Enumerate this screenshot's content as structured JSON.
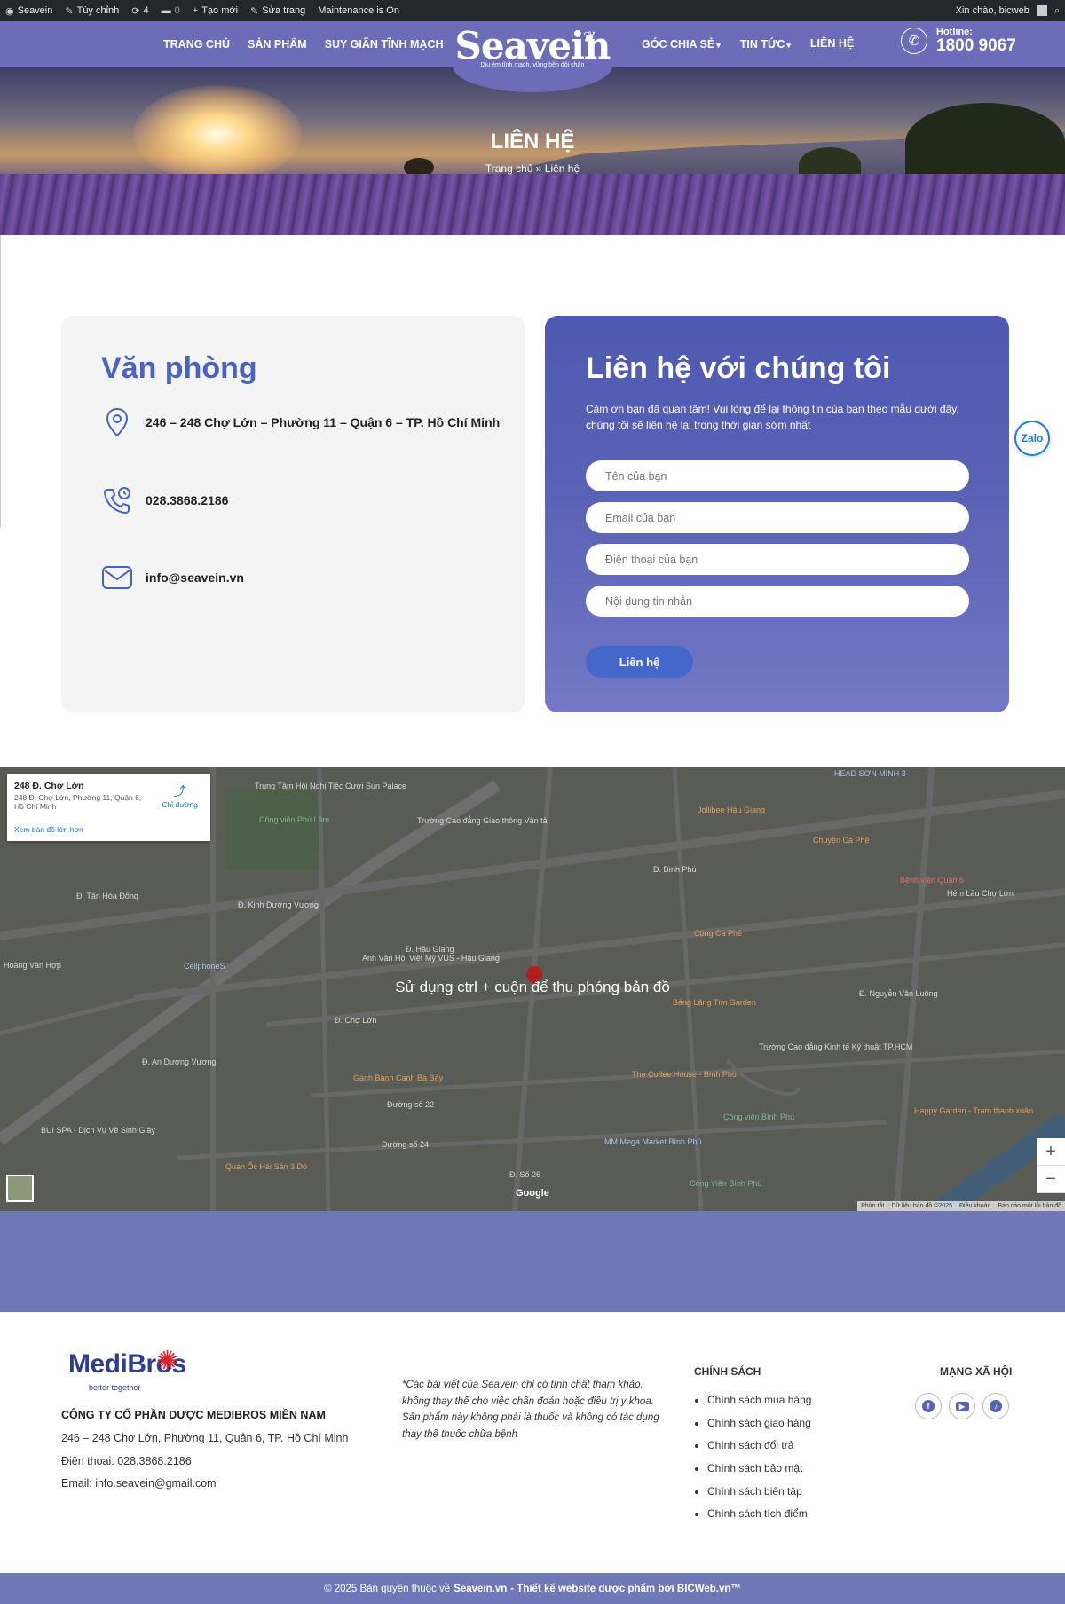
{
  "adminbar": {
    "site": "Seavein",
    "customize": "Tùy chỉnh",
    "updates": "4",
    "comments": "0",
    "new": "Tạo mới",
    "edit": "Sửa trang",
    "maintenance": "Maintenance is On",
    "greeting": "Xin chào, bicweb"
  },
  "header": {
    "nav_left": [
      "TRANG CHỦ",
      "SẢN PHẨM",
      "SUY GIÃN TĨNH MẠCH"
    ],
    "nav_right": [
      "GÓC CHIA SẺ",
      "TIN TỨC",
      "LIÊN HỆ"
    ],
    "logo": "Seavein",
    "logo_tagline": "Dịu êm tĩnh mạch, vững bền đôi chân",
    "hotline_label": "Hotline:",
    "hotline_number": "1800 9067"
  },
  "banner": {
    "title": "LIÊN HỆ",
    "breadcrumb": "Trang chủ » Liên hệ"
  },
  "office": {
    "title": "Văn phòng",
    "address": "246 – 248 Chợ Lớn – Phường 11 – Quận 6 – TP. Hồ Chí Minh",
    "phone": "028.3868.2186",
    "email": "info@seavein.vn",
    "icons": [
      "location-icon",
      "phone-icon",
      "mail-icon"
    ]
  },
  "contact": {
    "title": "Liên hệ với chúng tôi",
    "description": "Cảm ơn bạn đã quan tâm! Vui lòng để lại thông tin của bạn theo mẫu dưới đây, chúng tôi sẽ liên hệ lại trong thời gian sớm nhất",
    "fields": {
      "name": "Tên của bạn",
      "email": "Email của bạn",
      "phone": "Điện thoại của bạn",
      "message": "Nội dung tin nhắn"
    },
    "submit": "Liên hệ"
  },
  "zalo": "Zalo",
  "map": {
    "card_title": "248 Đ. Chợ Lớn",
    "card_address": "248 Đ. Chợ Lớn, Phường 11, Quận 6, Hồ Chí Minh",
    "card_link": "Xem bản đồ lớn hơn",
    "directions": "Chỉ đường",
    "hint": "Sử dụng ctrl + cuộn để thu phóng bản đồ",
    "zoom_in": "+",
    "zoom_out": "−",
    "google": "Google",
    "footer_links": [
      "Phím tắt",
      "Dữ liệu bản đồ ©2025",
      "Điều khoản",
      "Báo cáo một lỗi bản đồ"
    ],
    "labels": [
      "Trung Tâm Hội Nghị Tiệc Cưới Sun Palace",
      "Công viên Phú Lâm",
      "Trường Cao đẳng Giao thông Vận tải",
      "Jollibee Hậu Giang",
      "Chuyện Cà Phê",
      "Bệnh viện Quận 6",
      "Hẻm Lầu Chợ Lớn",
      "HEAD SƠN MINH 3",
      "Cộng Cà Phê",
      "Anh Văn Hội Việt Mỹ VUS - Hậu Giang",
      "CellphoneS",
      "Bảng Lăng Tím Garden",
      "Gánh Bánh Canh Bà Bảy",
      "The Coffee House - Bình Phú",
      "Trường Cao đẳng Kinh tế Kỹ thuật TP.HCM",
      "Công viên Bình Phú",
      "Happy Garden - Trạm thanh xuân",
      "MM Mega Market Bình Phú",
      "BUI SPA - Dịch Vụ Về Sinh Giày",
      "Quán Ốc Hải Sản 3 Dô",
      "Công Viên Bình Phú",
      "Đ. Hậu Giang",
      "Đ. Chợ Lớn",
      "Đ. Kinh Dương Vương",
      "Hoàng Văn Hợp",
      "Đường số 22",
      "Đường số 24",
      "Đ. Số 26",
      "Đ. An Dương Vương",
      "Đ. Nguyễn Văn Luông",
      "Đ. Bình Phú",
      "Đ. Tân Hòa Đông"
    ]
  },
  "footer": {
    "brand": "MediBros",
    "brand_tagline": "better together",
    "company": "CÔNG TY CỔ PHẦN DƯỢC MEDIBROS MIỀN NAM",
    "address": "246 – 248 Chợ Lớn, Phường 11, Quận 6, TP. Hồ Chí Minh",
    "phone": "Điện thoại: 028.3868.2186",
    "email": "Email: info.seavein@gmail.com",
    "note": "*Các bài viết của Seavein chỉ có tính chất tham khảo, không thay thế cho việc chẩn đoán hoặc điều trị y khoa. Sản phẩm này không phải là thuốc và không có tác dụng thay thế thuốc chữa bệnh",
    "policy_title": "CHÍNH SÁCH",
    "policies": [
      "Chính sách mua hàng",
      "Chính sách giao hàng",
      "Chính sách đổi trả",
      "Chính sách bảo mật",
      "Chính sách biên tập",
      "Chính sách tích điểm"
    ],
    "social_title": "MẠNG XÃ HỘI",
    "socials": [
      "facebook-icon",
      "youtube-icon",
      "tiktok-icon"
    ]
  },
  "copyright": {
    "prefix": "© 2025 Bản quyền thuộc về",
    "site": "Seavein.vn",
    "suffix": "- Thiết kế website dược phẩm bởi BICWeb.vn™"
  },
  "colors": {
    "brand_violet": "#6c6cb8",
    "title_blue": "#4a63c1",
    "button_blue": "#4567cc",
    "band": "#6e78b6"
  }
}
